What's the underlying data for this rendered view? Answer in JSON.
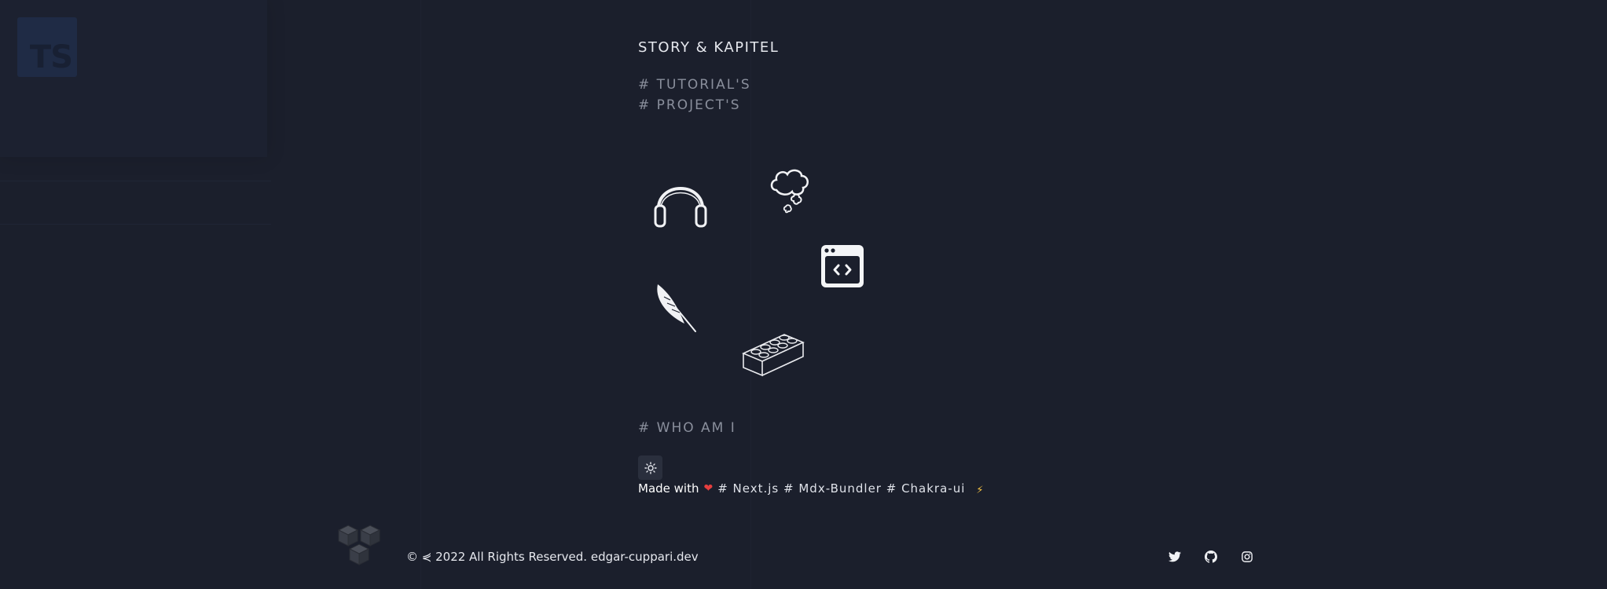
{
  "background": "#1b1f2c",
  "ts_logo": {
    "text": "TS"
  },
  "nav": {
    "title": "STORY & KAPITEL",
    "links": [
      {
        "label": "# TUTORIAL'S"
      },
      {
        "label": "# PROJECT'S"
      }
    ]
  },
  "icons": [
    "headphones-icon",
    "thought-bubble-icon",
    "code-window-icon",
    "feather-icon",
    "lego-brick-icon"
  ],
  "whoami": {
    "label": "# WHO AM I"
  },
  "theme_toggle": {
    "icon": "sun-icon"
  },
  "made_with": {
    "prefix": "Made with",
    "heart": "❤",
    "tech": "# Next.js # Mdx-Bundler # Chakra-ui",
    "bolt": "⚡"
  },
  "footer": {
    "copyright": "© ⋞ 2022 All Rights Reserved. edgar-cuppari.dev",
    "social": [
      "twitter-icon",
      "github-icon",
      "instagram-icon"
    ]
  },
  "colors": {
    "heart": "#e53e3e",
    "bolt": "#f6c343",
    "muted": "#8a8f9c"
  }
}
